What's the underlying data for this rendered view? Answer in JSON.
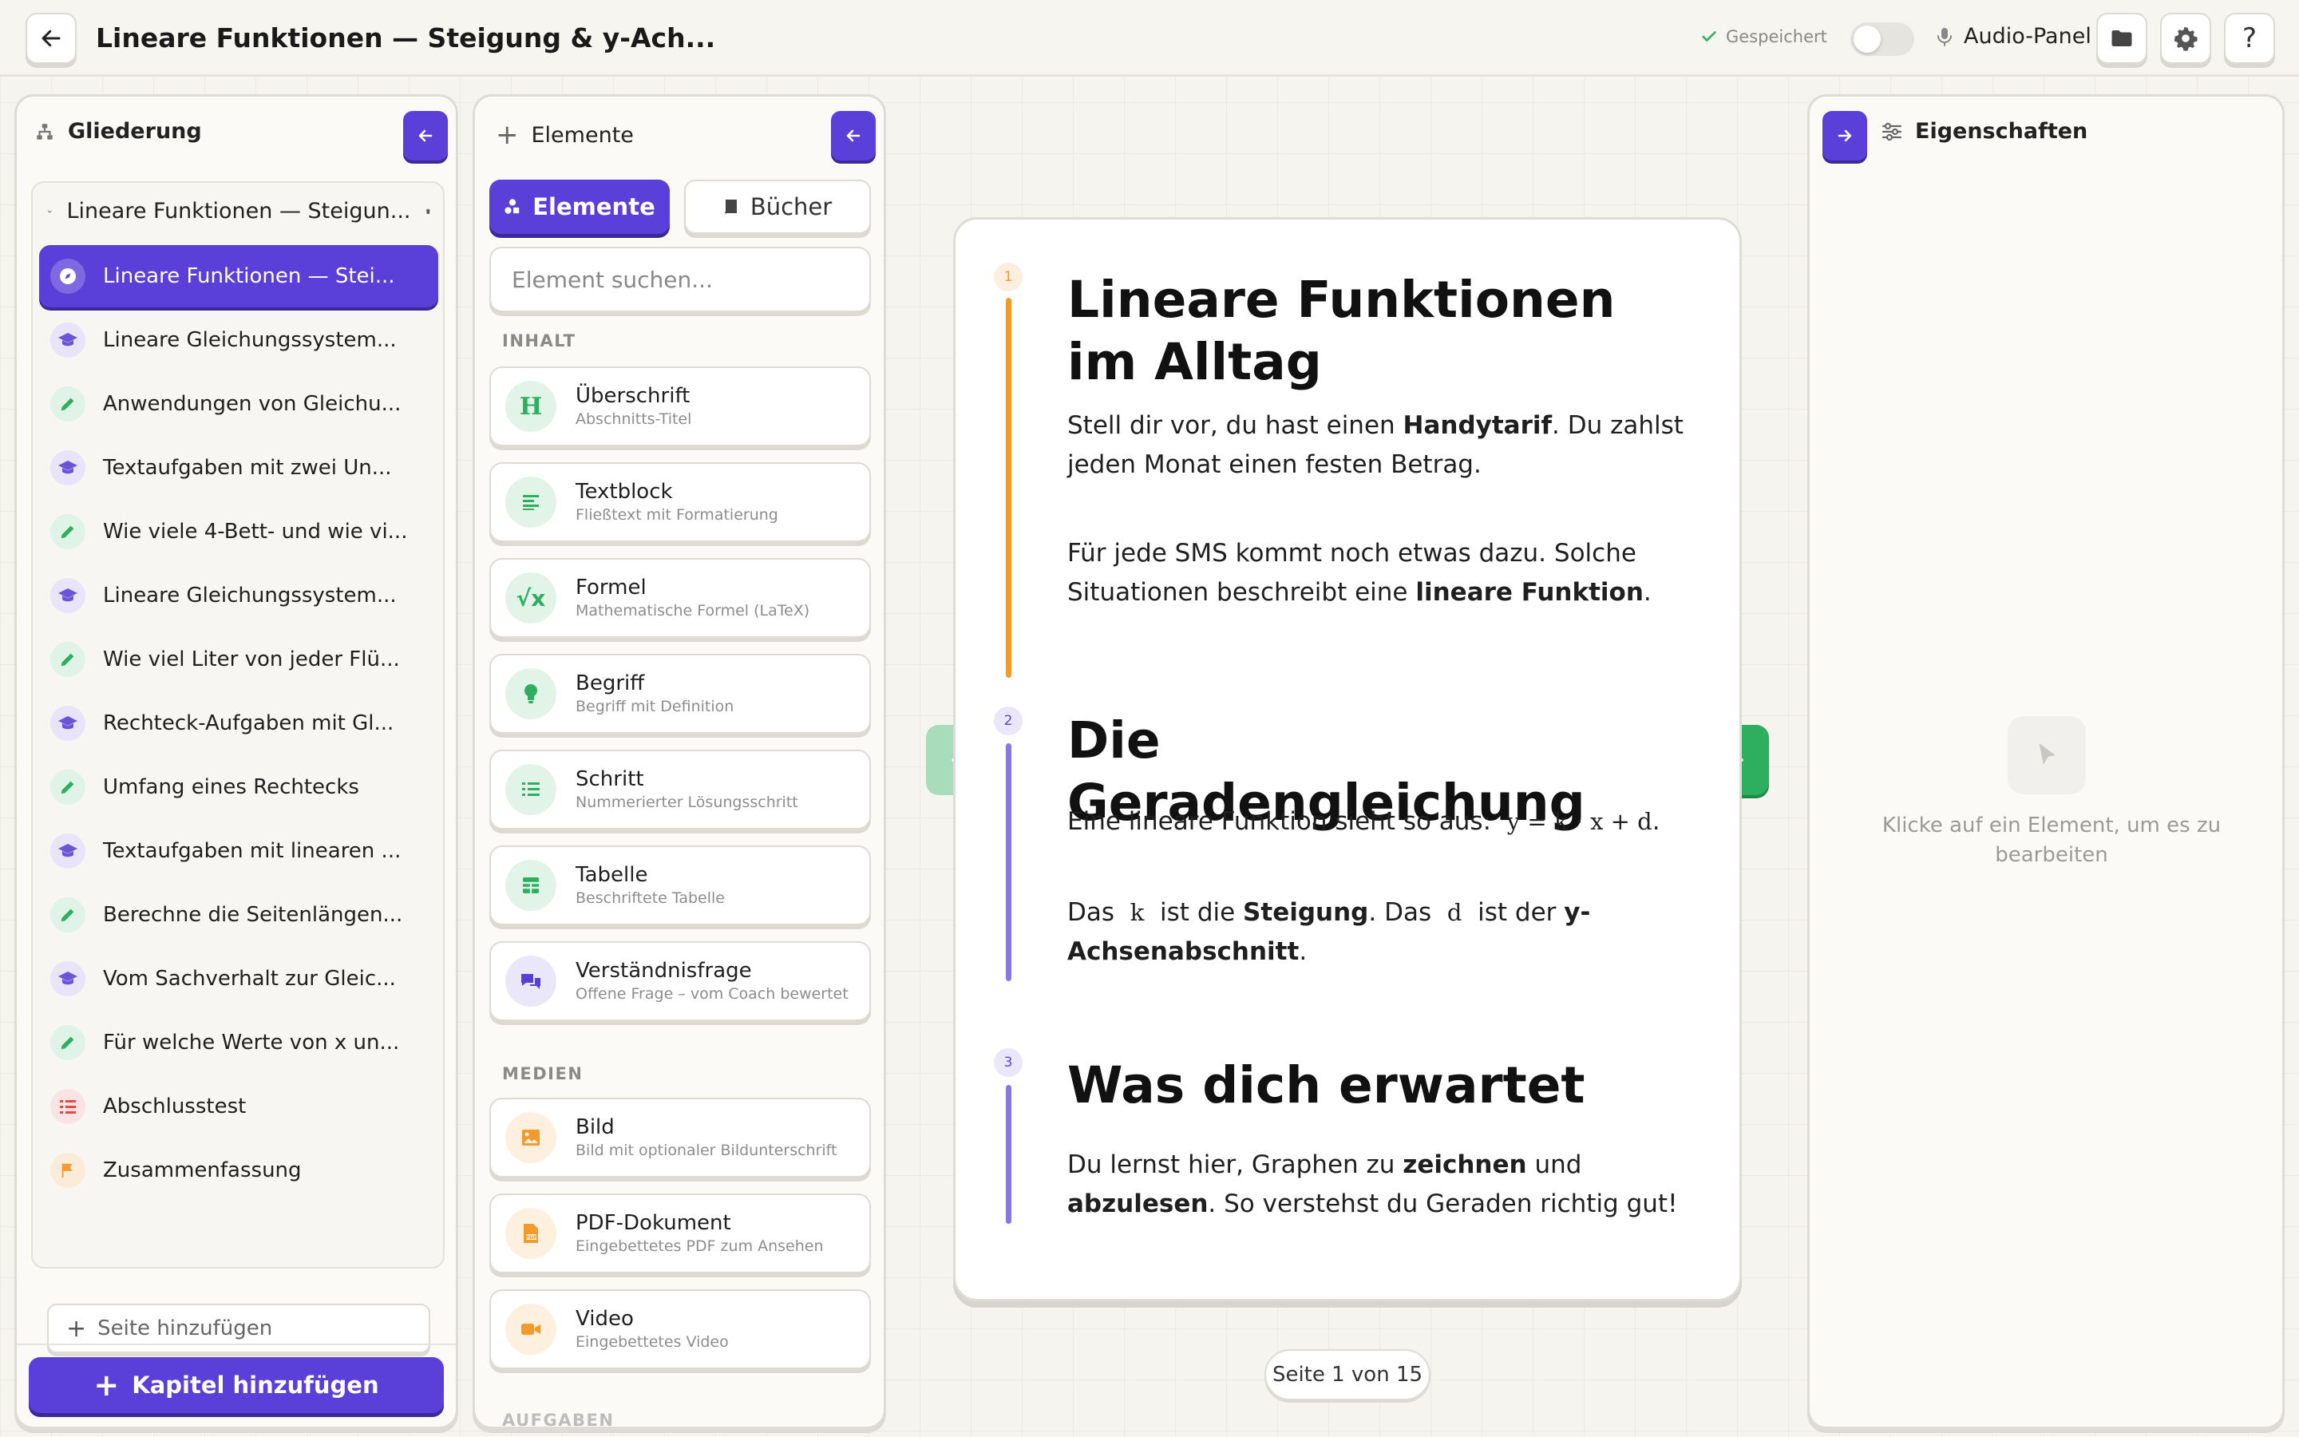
{
  "header": {
    "back_icon": "arrow-left-icon",
    "title": "Lineare Funktionen — Steigung & y-Ach...",
    "saved_label": "Gespeichert",
    "audio_label": "Audio-Panel",
    "icons": [
      "folder-icon",
      "gear-icon",
      "help-icon"
    ]
  },
  "outline": {
    "title": "Gliederung",
    "chapter_title": "Lineare Funktionen — Steigun...",
    "pages": [
      {
        "label": "Lineare Funktionen — Stei...",
        "icon": "compass-icon",
        "active": true
      },
      {
        "label": "Lineare Gleichungssystem...",
        "icon": "graduation-cap-icon"
      },
      {
        "label": "Anwendungen von Gleichu...",
        "icon": "pencil-icon"
      },
      {
        "label": "Textaufgaben mit zwei Un...",
        "icon": "graduation-cap-icon"
      },
      {
        "label": "Wie viele 4-Bett- und wie vi...",
        "icon": "pencil-icon"
      },
      {
        "label": "Lineare Gleichungssystem...",
        "icon": "graduation-cap-icon"
      },
      {
        "label": "Wie viel Liter von jeder Flü...",
        "icon": "pencil-icon"
      },
      {
        "label": "Rechteck-Aufgaben mit Gl...",
        "icon": "graduation-cap-icon"
      },
      {
        "label": "Umfang eines Rechtecks",
        "icon": "pencil-icon"
      },
      {
        "label": "Textaufgaben mit linearen ...",
        "icon": "graduation-cap-icon"
      },
      {
        "label": "Berechne die Seitenlängen...",
        "icon": "pencil-icon"
      },
      {
        "label": "Vom Sachverhalt zur Gleic...",
        "icon": "graduation-cap-icon"
      },
      {
        "label": "Für welche Werte von x un...",
        "icon": "pencil-icon"
      },
      {
        "label": "Abschlusstest",
        "icon": "checklist-icon"
      },
      {
        "label": "Zusammenfassung",
        "icon": "flag-icon"
      }
    ],
    "add_page": "Seite hinzufügen",
    "add_chapter": "Kapitel hinzufügen"
  },
  "elements": {
    "title": "Elemente",
    "tabs": [
      "Elemente",
      "Bücher"
    ],
    "search_placeholder": "Element suchen...",
    "section_content": "INHALT",
    "section_media": "MEDIEN",
    "section_next": "AUFGABEN",
    "content_items": [
      {
        "title": "Überschrift",
        "sub": "Abschnitts-Titel",
        "icon": "heading-icon"
      },
      {
        "title": "Textblock",
        "sub": "Fließtext mit Formatierung",
        "icon": "text-lines-icon"
      },
      {
        "title": "Formel",
        "sub": "Mathematische Formel (LaTeX)",
        "icon": "square-root-icon"
      },
      {
        "title": "Begriff",
        "sub": "Begriff mit Definition",
        "icon": "lightbulb-icon"
      },
      {
        "title": "Schritt",
        "sub": "Nummerierter Lösungsschritt",
        "icon": "numbered-list-icon"
      },
      {
        "title": "Tabelle",
        "sub": "Beschriftete Tabelle",
        "icon": "table-icon"
      },
      {
        "title": "Verständnisfrage",
        "sub": "Offene Frage – vom Coach bewertet",
        "icon": "chat-bubbles-icon"
      }
    ],
    "media_items": [
      {
        "title": "Bild",
        "sub": "Bild mit optionaler Bildunterschrift",
        "icon": "image-icon"
      },
      {
        "title": "PDF-Dokument",
        "sub": "Eingebettetes PDF zum Ansehen",
        "icon": "pdf-icon"
      },
      {
        "title": "Video",
        "sub": "Eingebettetes Video",
        "icon": "video-icon"
      }
    ]
  },
  "canvas": {
    "blocks": [
      {
        "number": "1",
        "heading": "Lineare Funktionen im Alltag",
        "p1_a": "Stell dir vor, du hast einen ",
        "p1_b": "Handytarif",
        "p1_c": ". Du zahlst jeden Monat einen festen Betrag.",
        "p2_a": "Für jede SMS kommt noch etwas dazu. Solche Situationen beschreibt eine ",
        "p2_b": "lineare Funktion",
        "p2_c": "."
      },
      {
        "number": "2",
        "heading": "Die Geradengleichung",
        "p1_a": "Eine lineare Funktion sieht so aus:",
        "p1_formula": "y = k · x + d",
        "p1_c": ".",
        "p2_a": "Das",
        "p2_k": "k",
        "p2_b": "ist die",
        "p2_bold1": "Steigung",
        "p2_c": ". Das",
        "p2_d": "d",
        "p2_e": "ist der",
        "p2_bold2": "y-Achsenabschnitt",
        "p2_f": "."
      },
      {
        "number": "3",
        "heading": "Was dich erwartet",
        "p1_a": "Du lernst hier, Graphen zu ",
        "p1_b": "zeichnen",
        "p1_c": " und ",
        "p1_d": "abzulesen",
        "p1_e": ". So verstehst du Geraden richtig gut!"
      }
    ],
    "page_indicator": "Seite 1 von 15"
  },
  "properties": {
    "title": "Eigenschaften",
    "empty_hint": "Klicke auf ein Element, um es zu bearbeiten"
  },
  "colors": {
    "accent": "#5b3fd9",
    "green": "#2eae5f",
    "orange": "#f29a2e",
    "purple_light": "#8b77e3"
  }
}
